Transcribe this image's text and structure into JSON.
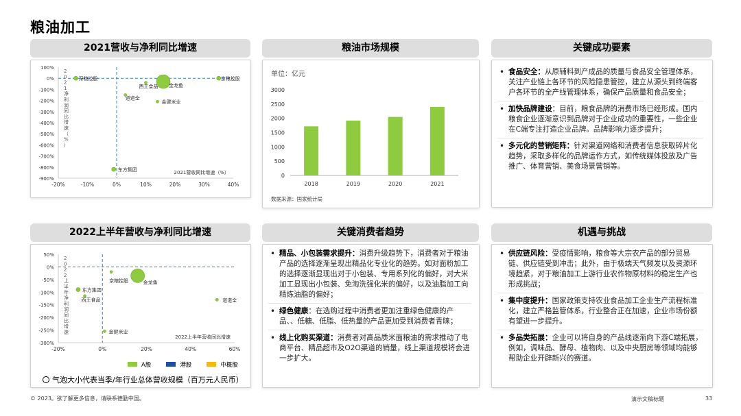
{
  "page": {
    "title": "粮油加工"
  },
  "panels": {
    "chart1": {
      "title": "2021营收与净利同比增速"
    },
    "chart2": {
      "title": "粮油市场规模"
    },
    "factors": {
      "title": "关键成功要素"
    },
    "chart3": {
      "title": "2022上半年营收与净利同比增速"
    },
    "trends": {
      "title": "关键消费者趋势"
    },
    "opps": {
      "title": "机遇与挑战"
    }
  },
  "chart_data": [
    {
      "type": "scatter",
      "title": "2021营收与净利同比增速",
      "xlabel": "2021营收同比增速（%）",
      "ylabel": "2021净利润同比增速（%）",
      "xlim": [
        -20,
        40
      ],
      "ylim": [
        -900,
        100
      ],
      "x_ticks": [
        "-20%",
        "-10%",
        "0%",
        "10%",
        "20%",
        "30%",
        "40%"
      ],
      "y_ticks": [
        "100%",
        "0%",
        "-100%",
        "-200%",
        "-300%",
        "-400%",
        "-500%",
        "-600%",
        "-700%",
        "-800%",
        "-900%"
      ],
      "points": [
        {
          "name": "深粮控股",
          "x": -14,
          "y": 0,
          "size": 3
        },
        {
          "name": "金龙鱼",
          "x": 16,
          "y": -30,
          "size": 10
        },
        {
          "name": "西王食品",
          "x": 10,
          "y": -40,
          "size": 2
        },
        {
          "name": "道道全",
          "x": 3,
          "y": -150,
          "size": 2
        },
        {
          "name": "金健米业",
          "x": 14,
          "y": -210,
          "size": 2
        },
        {
          "name": "京粮控股",
          "x": 35,
          "y": 0,
          "size": 3
        },
        {
          "name": "东方集团",
          "x": -1,
          "y": -820,
          "size": 3
        }
      ]
    },
    {
      "type": "bar",
      "title": "粮油市场规模",
      "unit_label": "单位：亿元",
      "categories": [
        "2018",
        "2019",
        "2020",
        "2021"
      ],
      "values": [
        1720,
        1920,
        2050,
        2400
      ],
      "ylim": [
        0,
        3000
      ],
      "y_ticks": [
        "3000",
        "2500",
        "2000",
        "1500",
        "1000",
        "500",
        "0"
      ],
      "color": "#8fcb3e",
      "source": "数据来源：国家统计局"
    },
    {
      "type": "scatter",
      "title": "2022上半年营收与净利同比增速",
      "xlabel": "2022上半年营收同比增速",
      "ylabel": "2022上半年净利润同比增速",
      "xlim": [
        -20,
        60
      ],
      "ylim": [
        -300,
        50
      ],
      "x_ticks": [
        "-20%",
        "0%",
        "20%",
        "40%",
        "60%"
      ],
      "y_ticks": [
        "50%",
        "0%",
        "-50%",
        "-100%",
        "-150%",
        "-200%",
        "-250%",
        "-300%"
      ],
      "points": [
        {
          "name": "金龙鱼",
          "x": 16,
          "y": -35,
          "size": 10
        },
        {
          "name": "京粮控股",
          "x": 4,
          "y": -20,
          "size": 2
        },
        {
          "name": "东方集团",
          "x": -11,
          "y": -90,
          "size": 3
        },
        {
          "name": "西王食品",
          "x": -8,
          "y": -115,
          "size": 2
        },
        {
          "name": "道道全",
          "x": 52,
          "y": -130,
          "size": 2
        },
        {
          "name": "金健米业",
          "x": 1,
          "y": -255,
          "size": 2
        }
      ],
      "legend": [
        {
          "name": "A股",
          "color": "#8fcb3e"
        },
        {
          "name": "港股",
          "color": "#1d4ea0"
        },
        {
          "name": "中概股",
          "color": "#f5b80c"
        }
      ],
      "bubble_note": "气泡大小代表当季/年行业总体营收规模（百万元人民币）"
    }
  ],
  "factors": [
    {
      "head": "食品安全：",
      "text": "从原辅料到产成品的质量与食品安全管理体系，关注产业链上各环节的风险隐患管控，建立从源头到终端客户各环节的全产线管理体系，确保产品质量和食品安全；"
    },
    {
      "head": "加快品牌建设",
      "text": "：目前，粮食品牌的消费市场已经形成。国内粮食企业逐渐意识到品牌对于企业成功的重要性，一些企业在C端专注打造企业品牌。品牌影响力逐步提升；"
    },
    {
      "head": "多元化的营销矩阵：",
      "text": "针对渠道网络和消费者信息获取碎片化趋势，采取多样化的品牌运作方式，如传统媒体投放及广告推广、体育营销、美食场景营销等。"
    }
  ],
  "trends": [
    {
      "head": "精品、小包装需求提升：",
      "text": "消费升级趋势下，消费者对于粮油产品的选择逐渐呈现出精品化专业化的趋势。如对面粉加工的选择逐渐显现出对于小包装、专用系列化的偏好，对大米加工显现出小包装、免淘洗强化米的偏好，以及油脂加工向精炼油脂的偏好；"
    },
    {
      "head": "绿色健康",
      "text": "：在选购过程中消费者更加注重绿色健康的产品、、低糖、低脂、低热量的产品更加受到消费者青睐；"
    },
    {
      "head": "线上化购买渠道：",
      "text": "消费者对高品质米面粮油的需求推动了电商平台、精品超市及O2O渠道的销量，线上渠道规模将会进一步扩大。"
    }
  ],
  "opps": [
    {
      "head": "供应链风险：",
      "text": "受疫情影响，粮食等大宗农产品的部分贸易链、供应链受到冲击；此外，由于极端天气频发以及资源环境趋紧，对于粮油加工上游行业农作物原材料的稳定生产也形成挑战；"
    },
    {
      "head": "集中度提升：",
      "text": "国家政策支持农业食品加工企业生产流程标准化，建立严格监管体系，行业整合正在加速，企业市场份额有望进一步提升。"
    },
    {
      "head": "多品类拓展：",
      "text": "企业可以将自身的产品线逐渐向下游C端拓展，例如，调味品、酵母、植物肉、以及中央厨房等领域均能够帮助企业开辟新兴的赛道。"
    }
  ],
  "footer": {
    "copyright": "© 2023。欲了解更多信息，请联系德勤中国。",
    "deck": "演示文稿标题",
    "page_number": "33"
  }
}
